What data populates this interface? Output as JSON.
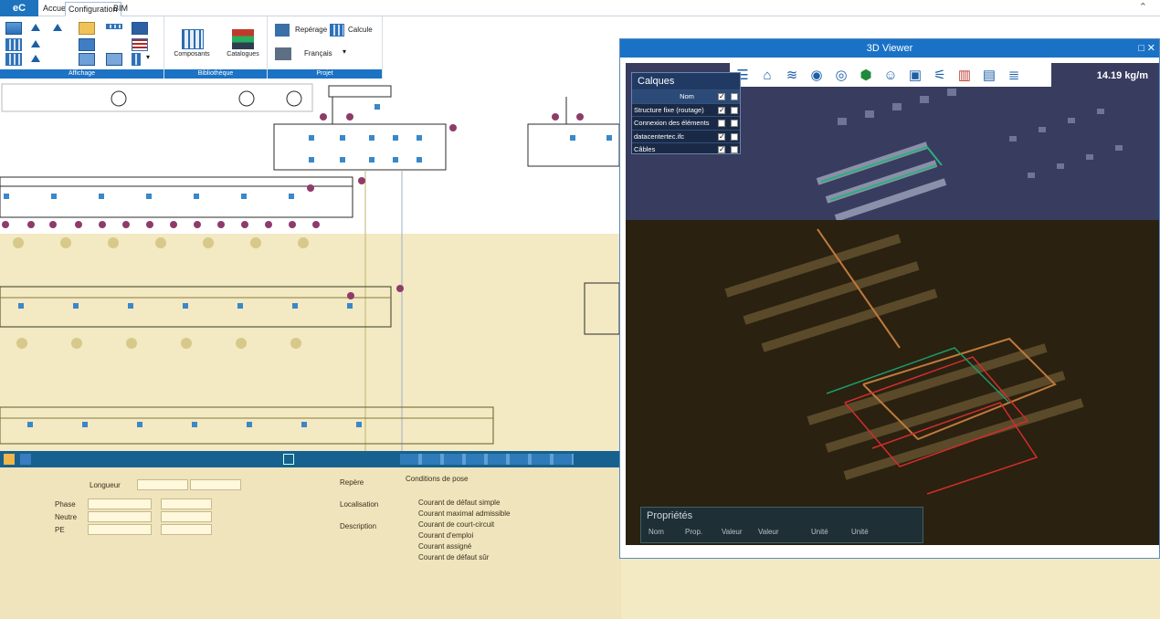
{
  "tabs": {
    "logo": "eC",
    "items": [
      "Accueil",
      "Configuration",
      "BIM"
    ]
  },
  "ribbon": {
    "groups": {
      "affichage": "Affichage",
      "bibliotheque": "Bibliothèque",
      "projet": "Projet"
    },
    "buttons": {
      "composants": "Composants",
      "catalogues": "Catalogues",
      "reperage": "Repérage",
      "calcule": "Calcule",
      "langue": "Français"
    }
  },
  "viewer": {
    "title": "3D Viewer",
    "weight": "14.19 kg/m",
    "layers": {
      "title": "Calques",
      "column": "Nom",
      "rows": [
        {
          "name": "Structure fixe (routage)",
          "visible": true
        },
        {
          "name": "Connexion des éléments",
          "visible": false
        },
        {
          "name": "datacentertec.ifc",
          "visible": true
        },
        {
          "name": "Câbles",
          "visible": true
        }
      ]
    },
    "properties": {
      "title": "Propriétés",
      "columns": [
        "Nom",
        "Prop.",
        "Valeur",
        "Valeur",
        "Unité",
        "Unité"
      ]
    }
  },
  "bottom": {
    "labels": {
      "longueur": "Longueur",
      "phase": "Phase",
      "neutre": "Neutre",
      "pe": "PE",
      "repere": "Repère",
      "localisation": "Localisation",
      "description": "Description",
      "conditions": "Conditions de pose",
      "courants": [
        "Courant de défaut simple",
        "Courant maximal admissible",
        "Courant de court-circuit",
        "Courant d'emploi",
        "Courant assigné",
        "Courant de défaut sûr"
      ]
    }
  }
}
